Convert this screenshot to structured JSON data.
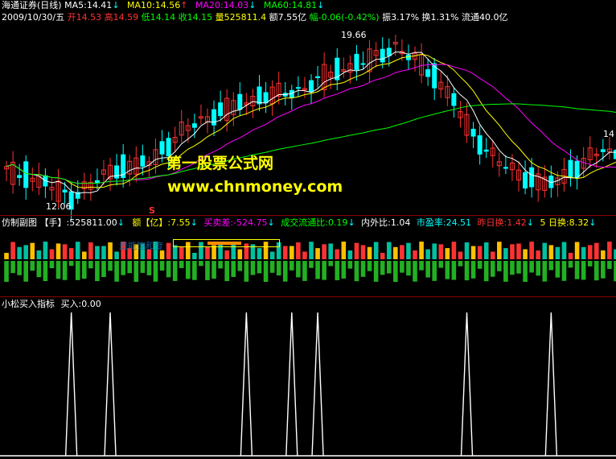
{
  "header": {
    "title": "海通证券(日线)",
    "ma5": "MA5:14.41",
    "ma10": "MA10:14.56",
    "ma20": "MA20:14.03",
    "ma60": "MA60:14.81",
    "arrow_down": "↓",
    "arrow_up": "↑",
    "date": "2009/10/30/五",
    "open": "开14.53",
    "high": "高14.59",
    "low": "低14.14",
    "close": "收14.15",
    "volume": "量525811.4",
    "amount": "额7.55亿",
    "change": "幅-0.06(-0.42%)",
    "amplitude": "振3.17%",
    "turnover": "换1.31%",
    "float": "流通40.0亿"
  },
  "colors": {
    "up": "#ff3232",
    "down": "#00ffff",
    "ma5": "#ffffff",
    "ma10": "#ffff00",
    "ma20": "#ff00ff",
    "ma60": "#00ff00",
    "bg": "#000000",
    "grid": "#8b0000"
  },
  "main_chart": {
    "high_label": "19.66",
    "low_label": "12.06",
    "right_label": "14",
    "marker": "S"
  },
  "watermark": {
    "line1": "第一股票公式网",
    "line2": "www.chnmoney.com"
  },
  "sub_panel": {
    "name": "仿制副图",
    "hand": "【手】:525811.00",
    "amount": "额【亿】:7.55",
    "buy_sell_diff": "买卖差:-524.75",
    "float_ratio": "成交流通比:0.19",
    "inout_ratio": "内外比:1.04",
    "pe": "市盈率:24.51",
    "prev_turnover": "昨日换:1.42",
    "five_day_turnover": "5 日换:8.32",
    "saturation_label": "量能饱和度"
  },
  "indicator_panel": {
    "name": "小松买入指标",
    "buy_value": "买入:0.00"
  },
  "chart_data": {
    "type": "candlestick",
    "title": "海通证券(日线)",
    "y_range": [
      11.8,
      20.2
    ],
    "extremes": {
      "high": 19.66,
      "low": 12.06
    },
    "last_bar": {
      "date": "2009/10/30",
      "open": 14.53,
      "high": 14.59,
      "low": 14.14,
      "close": 14.15
    },
    "moving_averages": {
      "MA5": 14.41,
      "MA10": 14.56,
      "MA20": 14.03,
      "MA60": 14.81
    },
    "buy_signal_bars": [
      10,
      16,
      37,
      44,
      48,
      71,
      84
    ]
  }
}
